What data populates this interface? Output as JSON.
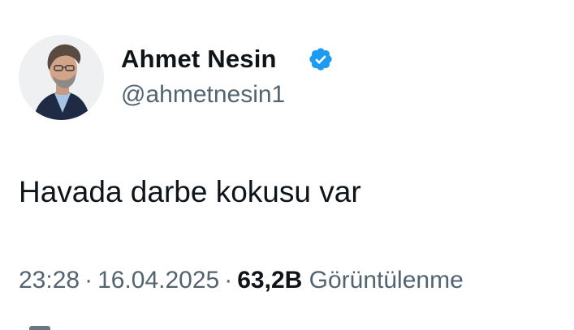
{
  "author": {
    "name": "Ahmet Nesin",
    "handle": "@ahmetnesin1",
    "verified": true,
    "verified_color": "#1d9bf0"
  },
  "tweet": {
    "text": "Havada darbe kokusu var"
  },
  "meta": {
    "time": "23:28",
    "separator": "·",
    "date": "16.04.2025",
    "views_count": "63,2B",
    "views_label": "Görüntülenme"
  },
  "colors": {
    "primary_text": "#0f1419",
    "secondary_text": "#536471",
    "background": "#ffffff"
  }
}
